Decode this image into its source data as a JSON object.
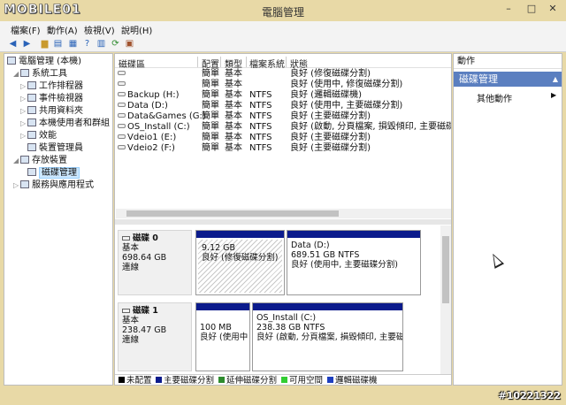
{
  "window": {
    "logo": "MOBILE01",
    "title": "電腦管理",
    "controls": [
      "–",
      "□",
      "✕"
    ]
  },
  "menu": [
    "檔案(F)",
    "動作(A)",
    "檢視(V)",
    "說明(H)"
  ],
  "toolbar_icons": [
    "back-icon",
    "forward-icon",
    "up-folder-icon",
    "console-tree-icon",
    "properties-icon",
    "help-icon",
    "show-hide-icon",
    "refresh-icon",
    "export-icon"
  ],
  "tree": [
    {
      "label": "電腦管理 (本機)",
      "level": 0,
      "arrow": ""
    },
    {
      "label": "系統工具",
      "level": 1,
      "arrow": "◢"
    },
    {
      "label": "工作排程器",
      "level": 2,
      "arrow": "▷"
    },
    {
      "label": "事件檢視器",
      "level": 2,
      "arrow": "▷"
    },
    {
      "label": "共用資料夾",
      "level": 2,
      "arrow": "▷"
    },
    {
      "label": "本機使用者和群組",
      "level": 2,
      "arrow": "▷"
    },
    {
      "label": "效能",
      "level": 2,
      "arrow": "▷"
    },
    {
      "label": "裝置管理員",
      "level": 2,
      "arrow": ""
    },
    {
      "label": "存放裝置",
      "level": 1,
      "arrow": "◢"
    },
    {
      "label": "磁碟管理",
      "level": 2,
      "arrow": "",
      "selected": true
    },
    {
      "label": "服務與應用程式",
      "level": 1,
      "arrow": "▷"
    }
  ],
  "volume_table": {
    "headers": [
      "磁碟區",
      "配置",
      "類型",
      "檔案系統",
      "狀態"
    ],
    "rows": [
      [
        "",
        "簡單",
        "基本",
        "",
        "良好 (修復磁碟分割)"
      ],
      [
        "",
        "簡單",
        "基本",
        "",
        "良好 (使用中, 修復磁碟分割)"
      ],
      [
        "Backup (H:)",
        "簡單",
        "基本",
        "NTFS",
        "良好 (邏輯磁碟機)"
      ],
      [
        "Data (D:)",
        "簡單",
        "基本",
        "NTFS",
        "良好 (使用中, 主要磁碟分割)"
      ],
      [
        "Data&Games (G:)",
        "簡單",
        "基本",
        "NTFS",
        "良好 (主要磁碟分割)"
      ],
      [
        "OS_Install (C:)",
        "簡單",
        "基本",
        "NTFS",
        "良好 (啟動, 分頁檔案, 損毀傾印, 主要磁碟分"
      ],
      [
        "Vdeio1 (E:)",
        "簡單",
        "基本",
        "NTFS",
        "良好 (主要磁碟分割)"
      ],
      [
        "Vdeio2 (F:)",
        "簡單",
        "基本",
        "NTFS",
        "良好 (主要磁碟分割)"
      ]
    ]
  },
  "disks": [
    {
      "name": "磁碟 0",
      "type": "基本",
      "size": "698.64 GB",
      "status": "連線",
      "partitions": [
        {
          "title": "",
          "size": "9.12 GB",
          "status": "良好 (修復磁碟分割)"
        },
        {
          "title": "Data  (D:)",
          "size": "689.51 GB NTFS",
          "status": "良好 (使用中, 主要磁碟分割)"
        }
      ]
    },
    {
      "name": "磁碟 1",
      "type": "基本",
      "size": "238.47 GB",
      "status": "連線",
      "partitions": [
        {
          "title": "",
          "size": "100 MB",
          "status": "良好 (使用中"
        },
        {
          "title": "OS_Install  (C:)",
          "size": "238.38 GB NTFS",
          "status": "良好 (啟動, 分頁檔案, 損毀傾印, 主要磁"
        }
      ]
    }
  ],
  "legend": [
    {
      "label": "未配置",
      "color": "#000000"
    },
    {
      "label": "主要磁碟分割",
      "color": "#0b1b8c"
    },
    {
      "label": "延伸磁碟分割",
      "color": "#2e8b2e"
    },
    {
      "label": "可用空間",
      "color": "#32cd32"
    },
    {
      "label": "邏輯磁碟機",
      "color": "#1e3fbf"
    }
  ],
  "actions": {
    "header": "動作",
    "section": "磁碟管理",
    "item": "其他動作"
  },
  "photo_id": "#10221322"
}
